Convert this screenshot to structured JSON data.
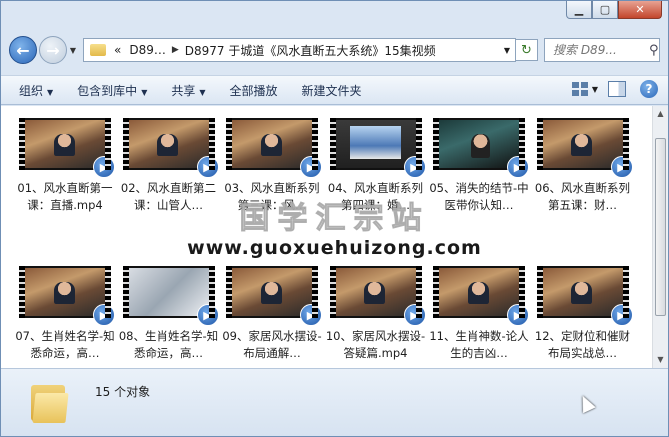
{
  "window": {
    "caption": {
      "minimize_icon": "minimize-icon",
      "maximize_icon": "maximize-icon",
      "close_icon": "close-icon"
    }
  },
  "address": {
    "overflow": "«",
    "crumbs": [
      "D89…",
      "D8977 于城道《风水直断五大系统》15集视频"
    ],
    "search_placeholder": "搜索 D89..."
  },
  "toolbar": {
    "organize": "组织",
    "include_in_library": "包含到库中",
    "share": "共享",
    "play_all": "全部播放",
    "new_folder": "新建文件夹"
  },
  "files": [
    {
      "label": "01、风水直断第一课：直播.mp4",
      "thumb": "person"
    },
    {
      "label": "02、风水直断第二课：山管人…",
      "thumb": "person"
    },
    {
      "label": "03、风水直断系列第三课：风…",
      "thumb": "person"
    },
    {
      "label": "04、风水直断系列第四课：婚…",
      "thumb": "screen"
    },
    {
      "label": "05、消失的结节-中医带你认知…",
      "thumb": "dark"
    },
    {
      "label": "06、风水直断系列第五课：财…",
      "thumb": "person"
    },
    {
      "label": "07、生肖姓名学-知悉命运，高…",
      "thumb": "person"
    },
    {
      "label": "08、生肖姓名学-知悉命运，高…",
      "thumb": "light"
    },
    {
      "label": "09、家居风水摆设-布局通解…",
      "thumb": "person"
    },
    {
      "label": "10、家居风水摆设-答疑篇.mp4",
      "thumb": "person"
    },
    {
      "label": "11、生肖神数-论人生的吉凶…",
      "thumb": "person"
    },
    {
      "label": "12、定财位和催财布局实战总…",
      "thumb": "person"
    }
  ],
  "watermark": {
    "cn": "国学汇宗站",
    "url": "www.guoxuehuizong.com"
  },
  "status": {
    "count": "15 个对象"
  }
}
